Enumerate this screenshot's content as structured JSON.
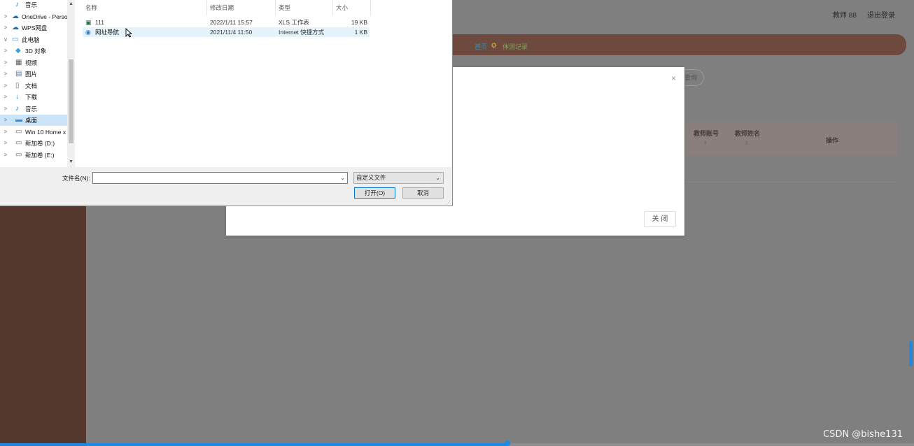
{
  "web_app": {
    "user_label": "教师 88",
    "logout_label": "退出登录",
    "breadcrumb_home": "首页",
    "breadcrumb_current": "体测记录",
    "search_button": "查询",
    "table_headers": [
      "教师账号",
      "教师姓名",
      "操作"
    ],
    "sort_icon": "sort-icon"
  },
  "modal": {
    "close_icon": "×",
    "close_button_label": "关 闭"
  },
  "file_dialog": {
    "nav_items": [
      {
        "label": "音乐",
        "icon": "music-icon",
        "indent": 1,
        "chevron": ""
      },
      {
        "label": "OneDrive - Perso",
        "icon": "cloud-icon",
        "indent": 0,
        "chevron": ">"
      },
      {
        "label": "WPS网盘",
        "icon": "cloud-icon",
        "indent": 0,
        "chevron": ">"
      },
      {
        "label": "此电脑",
        "icon": "computer-icon",
        "indent": 0,
        "chevron": "v"
      },
      {
        "label": "3D 对象",
        "icon": "cube-icon",
        "indent": 1,
        "chevron": ">"
      },
      {
        "label": "视频",
        "icon": "video-icon",
        "indent": 1,
        "chevron": ">"
      },
      {
        "label": "图片",
        "icon": "picture-icon",
        "indent": 1,
        "chevron": ">"
      },
      {
        "label": "文档",
        "icon": "document-icon",
        "indent": 1,
        "chevron": ">"
      },
      {
        "label": "下载",
        "icon": "download-icon",
        "indent": 1,
        "chevron": ">"
      },
      {
        "label": "音乐",
        "icon": "music-icon",
        "indent": 1,
        "chevron": ">"
      },
      {
        "label": "桌面",
        "icon": "desktop-icon",
        "indent": 1,
        "chevron": ">"
      },
      {
        "label": "Win 10 Home x",
        "icon": "drive-icon",
        "indent": 1,
        "chevron": ">"
      },
      {
        "label": "新加卷 (D:)",
        "icon": "drive-icon",
        "indent": 1,
        "chevron": ">"
      },
      {
        "label": "新加卷 (E:)",
        "icon": "drive-icon",
        "indent": 1,
        "chevron": ">"
      }
    ],
    "selected_nav_index": 10,
    "columns": {
      "name": "名称",
      "modified": "修改日期",
      "type": "类型",
      "size": "大小"
    },
    "files": [
      {
        "name": "111",
        "modified": "2022/1/11 15:57",
        "type": "XLS 工作表",
        "size": "19 KB",
        "icon": "spreadsheet-icon"
      },
      {
        "name": "网址导航",
        "modified": "2021/11/4 11:50",
        "type": "Internet 快捷方式",
        "size": "1 KB",
        "icon": "internet-shortcut-icon"
      }
    ],
    "filename_label": "文件名(N):",
    "filename_value": "",
    "filetype_value": "自定义文件",
    "open_button": "打开(O)",
    "cancel_button": "取消"
  },
  "video_progress": {
    "fraction": 0.555
  },
  "watermark": "CSDN @bishe131",
  "colors": {
    "brown_sidebar": "#55382e",
    "accent_blue": "#1e88e5",
    "selection": "#cce4f7"
  }
}
